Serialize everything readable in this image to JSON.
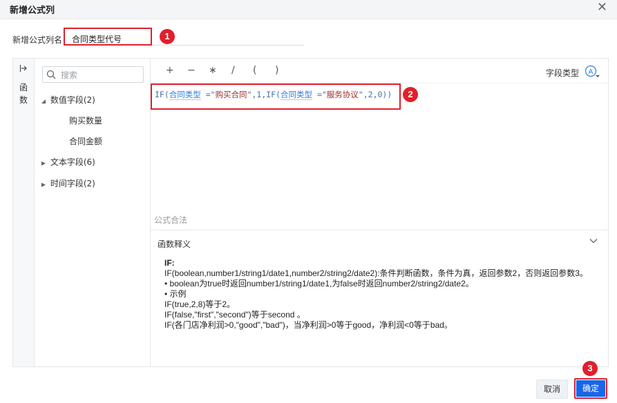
{
  "dialog": {
    "title": "新增公式列",
    "close_icon": "close-icon"
  },
  "name_field": {
    "label": "新增公式列名",
    "value": "合同类型代号"
  },
  "annotations": {
    "badge1": "1",
    "badge2": "2",
    "badge3": "3",
    "color": "#e0202c"
  },
  "rail": {
    "arrow_icon": "expand-arrow-icon",
    "label": "函数"
  },
  "field_panel": {
    "search_placeholder": "搜索",
    "search_icon": "search-icon",
    "groups": [
      {
        "label": "数值字段(2)",
        "expanded": true,
        "children": [
          "购买数量",
          "合同金额"
        ]
      },
      {
        "label": "文本字段(6)",
        "expanded": false,
        "children": []
      },
      {
        "label": "时间字段(2)",
        "expanded": false,
        "children": []
      }
    ]
  },
  "toolbar": {
    "operators": [
      "+",
      "−",
      "∗",
      "/",
      "(",
      ")"
    ],
    "field_type_label": "字段类型",
    "field_type_icon": "text-type-icon"
  },
  "formula": {
    "p1": "IF(",
    "field1": "合同类型",
    "p2": " =\"",
    "str1": "购买合同",
    "p3": "\",1,IF(",
    "field2": "合同类型",
    "p4": " =\"",
    "str2": "服务协议",
    "p5": "\",2,0))"
  },
  "validity_text": "公式合法",
  "explanation": {
    "header": "函数释义",
    "chevron_icon": "chevron-down-icon",
    "lines": [
      "IF:",
      "IF(boolean,number1/string1/date1,number2/string2/date2):条件判断函数，条件为真，返回参数2，否则返回参数3。",
      "• boolean为true时返回number1/string1/date1,为false时返回number2/string2/date2。",
      "• 示例",
      "IF(true,2,8)等于2。",
      "IF(false,\"first\",\"second\")等于second 。",
      "IF(各门店净利润>0,\"good\",\"bad\")，当净利润>0等于good，净利润<0等于bad。"
    ]
  },
  "footer": {
    "cancel_label": "取消",
    "ok_label": "确定"
  }
}
